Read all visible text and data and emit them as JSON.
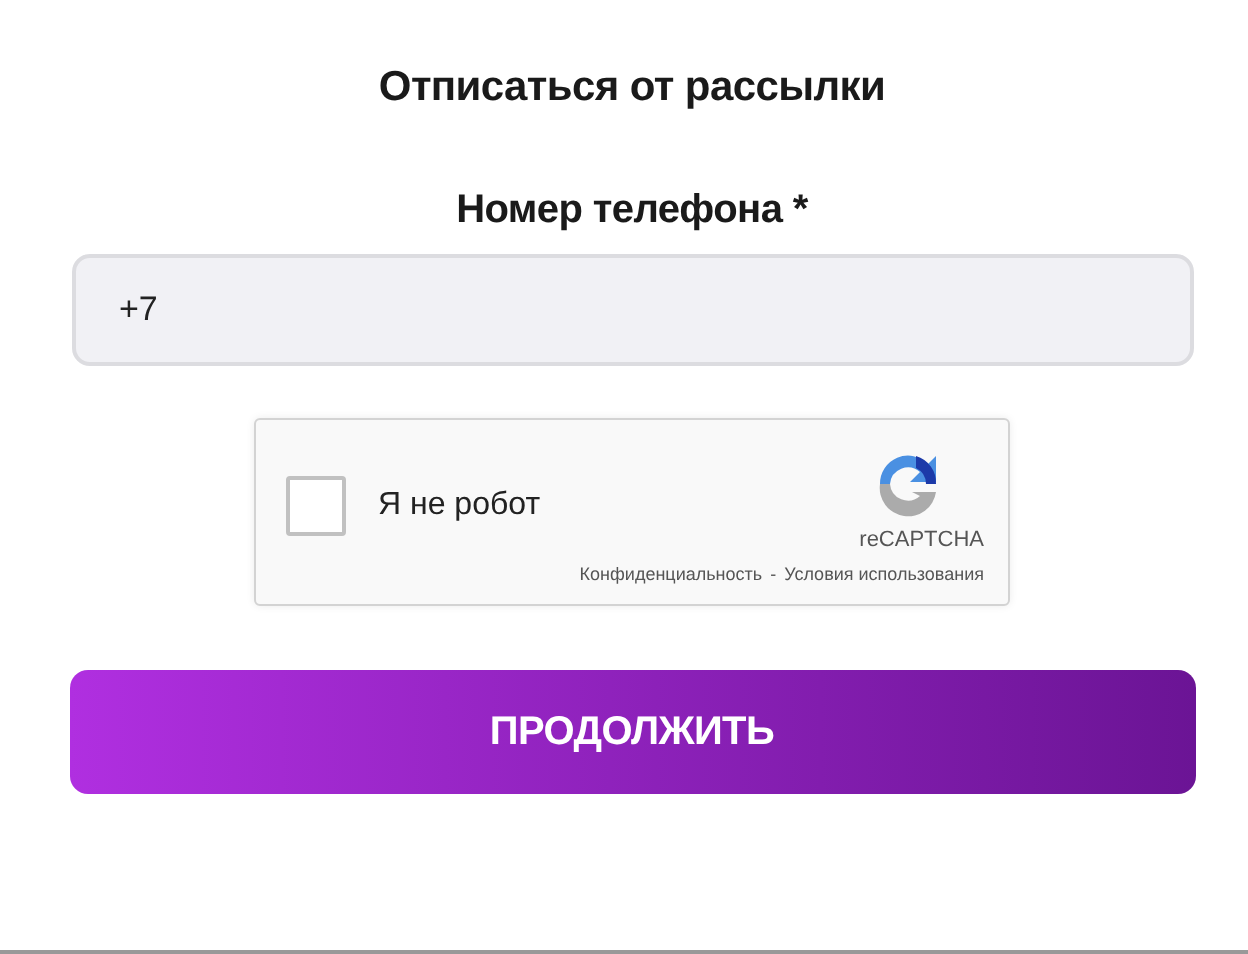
{
  "title": "Отписаться от рассылки",
  "phone_field": {
    "label": "Номер телефона *",
    "value": "+7"
  },
  "captcha": {
    "checked": false,
    "label": "Я не робот",
    "brand": "reCAPTCHA",
    "privacy_link": "Конфиденциальность",
    "separator": "-",
    "terms_link": "Условия использования"
  },
  "submit_button": "ПРОДОЛЖИТЬ"
}
